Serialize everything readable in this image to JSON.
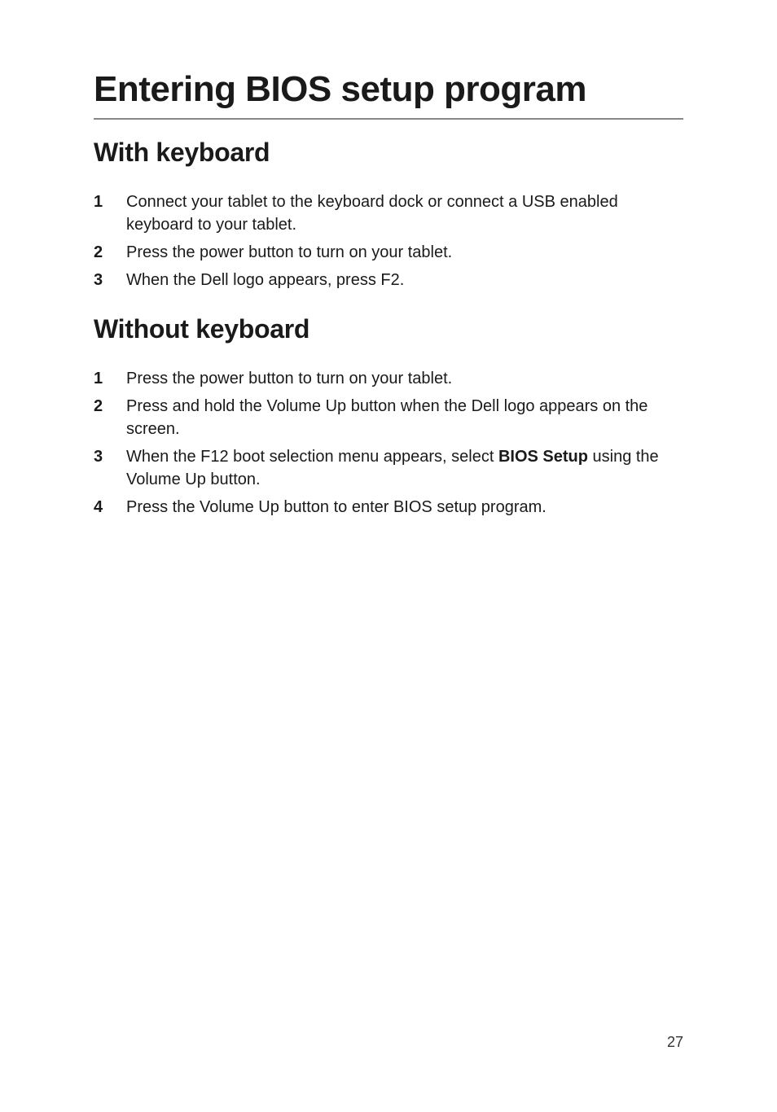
{
  "page": {
    "title": "Entering BIOS setup program",
    "pageNumber": "27"
  },
  "sections": [
    {
      "heading": "With keyboard",
      "steps": [
        {
          "pre": "Connect your tablet to the keyboard dock or connect a USB enabled keyboard to your tablet.",
          "bold": "",
          "post": ""
        },
        {
          "pre": "Press the power button to turn on your tablet.",
          "bold": "",
          "post": ""
        },
        {
          "pre": "When the Dell logo appears, press F2.",
          "bold": "",
          "post": ""
        }
      ]
    },
    {
      "heading": "Without keyboard",
      "steps": [
        {
          "pre": "Press the power button to turn on your tablet.",
          "bold": "",
          "post": ""
        },
        {
          "pre": "Press and hold the Volume Up button when the Dell logo appears on the screen.",
          "bold": "",
          "post": ""
        },
        {
          "pre": "When the F12 boot selection menu appears, select ",
          "bold": "BIOS Setup",
          "post": " using the Volume Up button."
        },
        {
          "pre": "Press the Volume Up button to enter BIOS setup program.",
          "bold": "",
          "post": ""
        }
      ]
    }
  ]
}
